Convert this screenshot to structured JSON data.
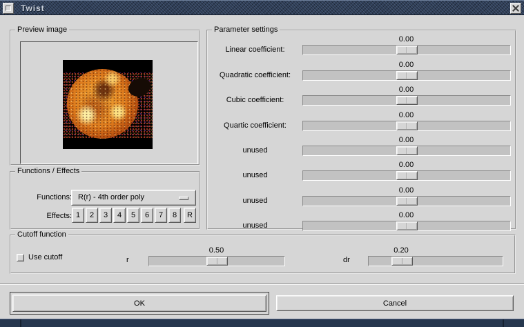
{
  "window": {
    "title": "Twist",
    "titlebar_color": "#2e3d56",
    "background_color": "#d6d6d6",
    "bottom_bar_color": "#26374e"
  },
  "preview": {
    "label": "Preview image",
    "image_description": "sun-preview-image"
  },
  "functions_effects": {
    "label": "Functions / Effects",
    "functions_label": "Functions:",
    "functions_selected": "R(r) - 4th order poly",
    "effects_label": "Effects:",
    "effect_buttons": [
      "1",
      "2",
      "3",
      "4",
      "5",
      "6",
      "7",
      "8",
      "R"
    ]
  },
  "parameters": {
    "label": "Parameter settings",
    "sliders": [
      {
        "label": "Linear coefficient:",
        "value": "0.00",
        "position": 0.5
      },
      {
        "label": "Quadratic coefficient:",
        "value": "0.00",
        "position": 0.5
      },
      {
        "label": "Cubic coefficient:",
        "value": "0.00",
        "position": 0.5
      },
      {
        "label": "Quartic coefficient:",
        "value": "0.00",
        "position": 0.5
      },
      {
        "label": "unused",
        "value": "0.00",
        "position": 0.5
      },
      {
        "label": "unused",
        "value": "0.00",
        "position": 0.5
      },
      {
        "label": "unused",
        "value": "0.00",
        "position": 0.5
      },
      {
        "label": "unused",
        "value": "0.00",
        "position": 0.5
      }
    ]
  },
  "cutoff": {
    "label": "Cutoff function",
    "checkbox_label": "Use cutoff",
    "checkbox_checked": false,
    "r": {
      "label": "r",
      "value": "0.50",
      "position": 0.5
    },
    "dr": {
      "label": "dr",
      "value": "0.20",
      "position": 0.2
    }
  },
  "actions": {
    "ok_label": "OK",
    "cancel_label": "Cancel"
  }
}
